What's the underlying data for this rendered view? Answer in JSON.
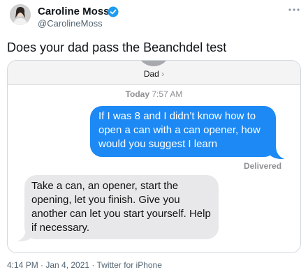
{
  "tweet": {
    "author_name": "Caroline Moss",
    "author_handle": "@CarolineMoss",
    "text": "Does your dad pass the Beanchdel test",
    "meta": "4:14 PM · Jan 4, 2021 · Twitter for iPhone",
    "more_icon": "more-dots-icon",
    "verified_icon": "verified-badge-icon"
  },
  "screenshot": {
    "contact_name": "Dad",
    "contact_chevron": "›",
    "timestamp_day": "Today",
    "timestamp_time": "7:57 AM",
    "outgoing_message": "If I was 8 and I didn’t know how to open a can with a can opener, how would you suggest I learn",
    "delivered_label": "Delivered",
    "incoming_message": "Take a can, an opener, start the opening, let you finish. Give you another can let you start yourself. Help if necessary."
  },
  "colors": {
    "outgoing_bubble": "#1c89f5",
    "incoming_bubble": "#e8e8ea",
    "verified": "#1d9bf0"
  }
}
